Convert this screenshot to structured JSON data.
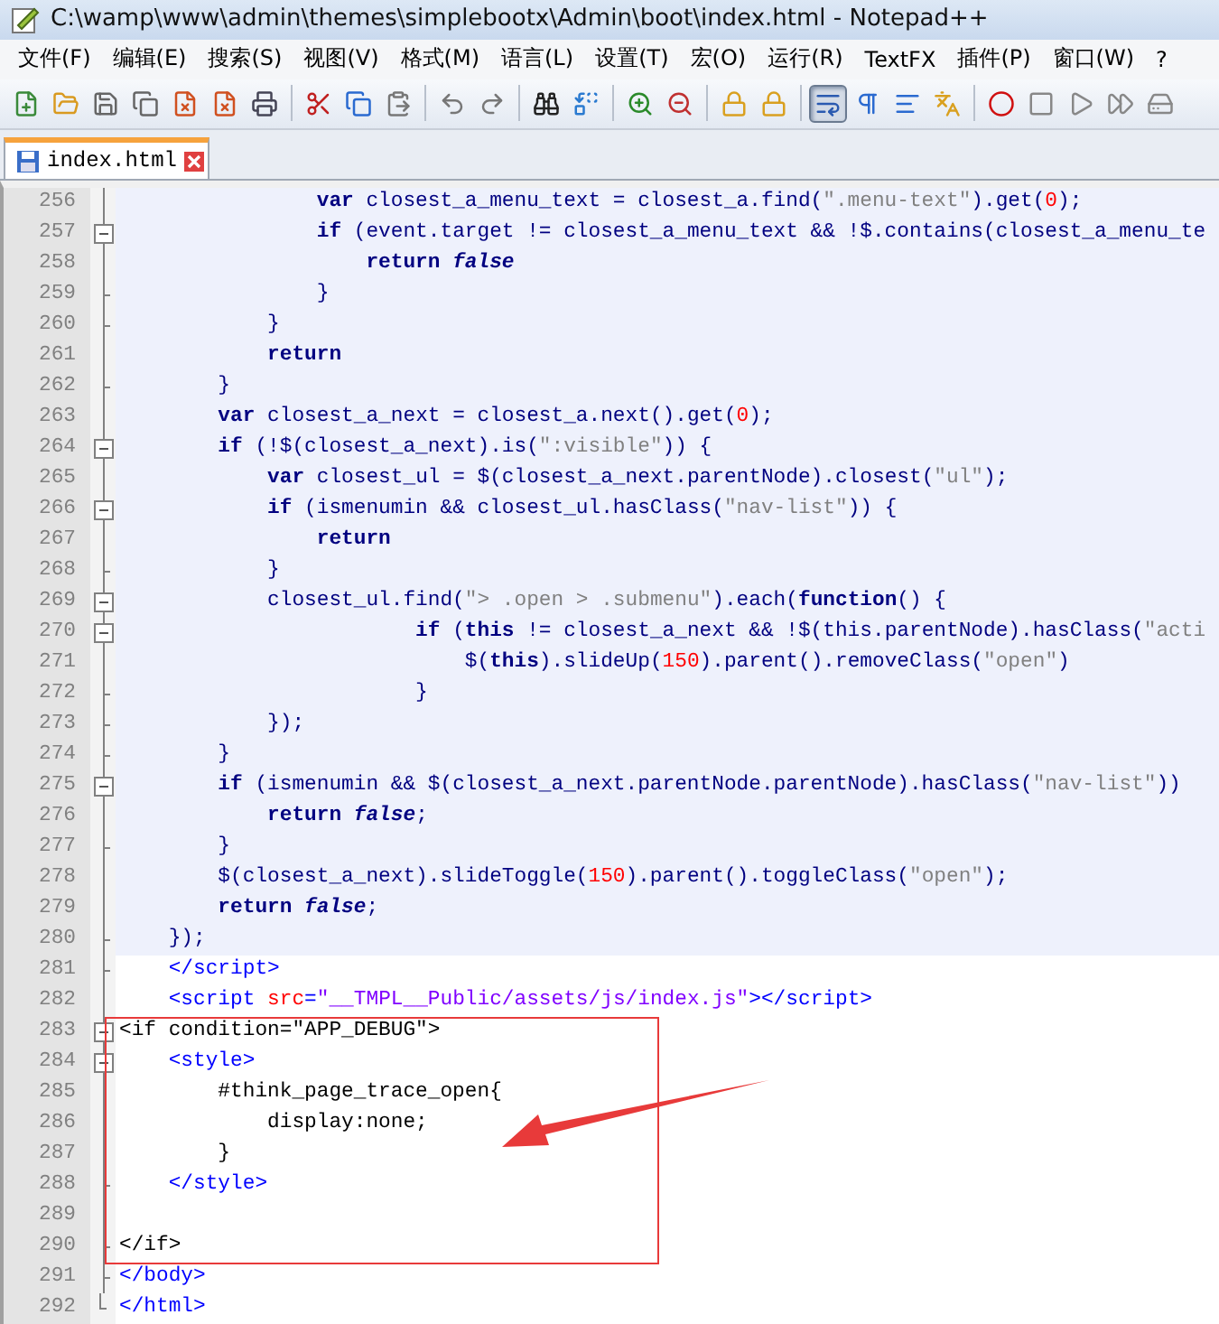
{
  "window": {
    "title": "C:\\wamp\\www\\admin\\themes\\simplebootx\\Admin\\boot\\index.html - Notepad++"
  },
  "menu": [
    "文件(F)",
    "编辑(E)",
    "搜索(S)",
    "视图(V)",
    "格式(M)",
    "语言(L)",
    "设置(T)",
    "宏(O)",
    "运行(R)",
    "TextFX",
    "插件(P)",
    "窗口(W)",
    "?"
  ],
  "toolbar": [
    {
      "kind": "new",
      "pressed": false
    },
    {
      "kind": "open",
      "pressed": false
    },
    {
      "kind": "save",
      "pressed": false
    },
    {
      "kind": "saveall",
      "pressed": false
    },
    {
      "kind": "close",
      "pressed": false
    },
    {
      "kind": "closeall",
      "pressed": false
    },
    {
      "kind": "print",
      "pressed": false
    },
    {
      "kind": "sep"
    },
    {
      "kind": "cut",
      "pressed": false
    },
    {
      "kind": "copy",
      "pressed": false
    },
    {
      "kind": "paste",
      "pressed": false
    },
    {
      "kind": "sep"
    },
    {
      "kind": "undo",
      "pressed": false
    },
    {
      "kind": "redo",
      "pressed": false
    },
    {
      "kind": "sep"
    },
    {
      "kind": "find",
      "pressed": false
    },
    {
      "kind": "replace",
      "pressed": false
    },
    {
      "kind": "sep"
    },
    {
      "kind": "zoomin",
      "pressed": false
    },
    {
      "kind": "zoomout",
      "pressed": false
    },
    {
      "kind": "sep"
    },
    {
      "kind": "syncv",
      "pressed": false
    },
    {
      "kind": "synch",
      "pressed": false
    },
    {
      "kind": "sep"
    },
    {
      "kind": "wrap",
      "pressed": true
    },
    {
      "kind": "allchars",
      "pressed": false
    },
    {
      "kind": "indent",
      "pressed": false
    },
    {
      "kind": "udl",
      "pressed": false
    },
    {
      "kind": "sep"
    },
    {
      "kind": "record",
      "pressed": false
    },
    {
      "kind": "stop",
      "pressed": false
    },
    {
      "kind": "play",
      "pressed": false
    },
    {
      "kind": "playmulti",
      "pressed": false
    },
    {
      "kind": "macro",
      "pressed": false
    }
  ],
  "tabs": [
    {
      "label": "index.html",
      "selected": true
    }
  ],
  "lines": [
    {
      "number": "256",
      "kind": "line",
      "shaded": true,
      "segments": [
        {
          "kind": "kw",
          "text": "                var"
        },
        {
          "kind": "op",
          "text": " closest_a_menu_text = closest_a.find("
        },
        {
          "kind": "str",
          "text": "\".menu-text\""
        },
        {
          "kind": "op",
          "text": ").get("
        },
        {
          "kind": "num",
          "text": "0"
        },
        {
          "kind": "op",
          "text": ");"
        }
      ]
    },
    {
      "number": "257",
      "kind": "open",
      "shaded": true,
      "segments": [
        {
          "kind": "kw",
          "text": "                if"
        },
        {
          "kind": "op",
          "text": " (event.target != closest_a_menu_text && !$.contains(closest_a_menu_te"
        }
      ]
    },
    {
      "number": "258",
      "kind": "line",
      "shaded": true,
      "segments": [
        {
          "kind": "kw",
          "text": "                    return"
        },
        {
          "kind": "ital",
          "text": " false"
        }
      ]
    },
    {
      "number": "259",
      "kind": "end",
      "shaded": true,
      "segments": [
        {
          "kind": "op",
          "text": "                }"
        }
      ]
    },
    {
      "number": "260",
      "kind": "end",
      "shaded": true,
      "segments": [
        {
          "kind": "op",
          "text": "            }"
        }
      ]
    },
    {
      "number": "261",
      "kind": "line",
      "shaded": true,
      "segments": [
        {
          "kind": "kw",
          "text": "            return"
        }
      ]
    },
    {
      "number": "262",
      "kind": "end",
      "shaded": true,
      "segments": [
        {
          "kind": "op",
          "text": "        }"
        }
      ]
    },
    {
      "number": "263",
      "kind": "line",
      "shaded": true,
      "segments": [
        {
          "kind": "kw",
          "text": "        var"
        },
        {
          "kind": "op",
          "text": " closest_a_next = closest_a.next().get("
        },
        {
          "kind": "num",
          "text": "0"
        },
        {
          "kind": "op",
          "text": ");"
        }
      ]
    },
    {
      "number": "264",
      "kind": "open",
      "shaded": true,
      "segments": [
        {
          "kind": "kw",
          "text": "        if"
        },
        {
          "kind": "op",
          "text": " (!$(closest_a_next).is("
        },
        {
          "kind": "str",
          "text": "\":visible\""
        },
        {
          "kind": "op",
          "text": ")) {"
        }
      ]
    },
    {
      "number": "265",
      "kind": "line",
      "shaded": true,
      "segments": [
        {
          "kind": "kw",
          "text": "            var"
        },
        {
          "kind": "op",
          "text": " closest_ul = $(closest_a_next.parentNode).closest("
        },
        {
          "kind": "str",
          "text": "\"ul\""
        },
        {
          "kind": "op",
          "text": ");"
        }
      ]
    },
    {
      "number": "266",
      "kind": "open",
      "shaded": true,
      "segments": [
        {
          "kind": "kw",
          "text": "            if"
        },
        {
          "kind": "op",
          "text": " (ismenumin && closest_ul.hasClass("
        },
        {
          "kind": "str",
          "text": "\"nav-list\""
        },
        {
          "kind": "op",
          "text": ")) {"
        }
      ]
    },
    {
      "number": "267",
      "kind": "line",
      "shaded": true,
      "segments": [
        {
          "kind": "kw",
          "text": "                return"
        }
      ]
    },
    {
      "number": "268",
      "kind": "end",
      "shaded": true,
      "segments": [
        {
          "kind": "op",
          "text": "            }"
        }
      ]
    },
    {
      "number": "269",
      "kind": "open",
      "shaded": true,
      "segments": [
        {
          "kind": "op",
          "text": "            closest_ul.find("
        },
        {
          "kind": "str",
          "text": "\"> .open > .submenu\""
        },
        {
          "kind": "op",
          "text": ").each("
        },
        {
          "kind": "kw",
          "text": "function"
        },
        {
          "kind": "op",
          "text": "() {"
        }
      ]
    },
    {
      "number": "270",
      "kind": "open",
      "shaded": true,
      "segments": [
        {
          "kind": "kw",
          "text": "                        if"
        },
        {
          "kind": "op",
          "text": " ("
        },
        {
          "kind": "kw",
          "text": "this"
        },
        {
          "kind": "op",
          "text": " != closest_a_next && !$(this.parentNode).hasClass("
        },
        {
          "kind": "str",
          "text": "\"acti"
        }
      ]
    },
    {
      "number": "271",
      "kind": "line",
      "shaded": true,
      "segments": [
        {
          "kind": "op",
          "text": "                            $("
        },
        {
          "kind": "kw",
          "text": "this"
        },
        {
          "kind": "op",
          "text": ").slideUp("
        },
        {
          "kind": "num",
          "text": "150"
        },
        {
          "kind": "op",
          "text": ").parent().removeClass("
        },
        {
          "kind": "str",
          "text": "\"open\""
        },
        {
          "kind": "op",
          "text": ")"
        }
      ]
    },
    {
      "number": "272",
      "kind": "end",
      "shaded": true,
      "segments": [
        {
          "kind": "op",
          "text": "                        }"
        }
      ]
    },
    {
      "number": "273",
      "kind": "end",
      "shaded": true,
      "segments": [
        {
          "kind": "op",
          "text": "            });"
        }
      ]
    },
    {
      "number": "274",
      "kind": "end",
      "shaded": true,
      "segments": [
        {
          "kind": "op",
          "text": "        }"
        }
      ]
    },
    {
      "number": "275",
      "kind": "open",
      "shaded": true,
      "segments": [
        {
          "kind": "kw",
          "text": "        if"
        },
        {
          "kind": "op",
          "text": " (ismenumin && $(closest_a_next.parentNode.parentNode).hasClass("
        },
        {
          "kind": "str",
          "text": "\"nav-list\""
        },
        {
          "kind": "op",
          "text": "))"
        }
      ]
    },
    {
      "number": "276",
      "kind": "line",
      "shaded": true,
      "segments": [
        {
          "kind": "kw",
          "text": "            return"
        },
        {
          "kind": "ital",
          "text": " false"
        },
        {
          "kind": "op",
          "text": ";"
        }
      ]
    },
    {
      "number": "277",
      "kind": "end",
      "shaded": true,
      "segments": [
        {
          "kind": "op",
          "text": "        }"
        }
      ]
    },
    {
      "number": "278",
      "kind": "line",
      "shaded": true,
      "segments": [
        {
          "kind": "op",
          "text": "        $(closest_a_next).slideToggle("
        },
        {
          "kind": "num",
          "text": "150"
        },
        {
          "kind": "op",
          "text": ").parent().toggleClass("
        },
        {
          "kind": "str",
          "text": "\"open\""
        },
        {
          "kind": "op",
          "text": ");"
        }
      ]
    },
    {
      "number": "279",
      "kind": "line",
      "shaded": true,
      "segments": [
        {
          "kind": "kw",
          "text": "        return"
        },
        {
          "kind": "ital",
          "text": " false"
        },
        {
          "kind": "op",
          "text": ";"
        }
      ]
    },
    {
      "number": "280",
      "kind": "end",
      "shaded": true,
      "segments": [
        {
          "kind": "op",
          "text": "    });"
        }
      ]
    },
    {
      "number": "281",
      "kind": "end",
      "shaded": false,
      "segments": [
        {
          "kind": "tag",
          "text": "    </script>"
        }
      ]
    },
    {
      "number": "282",
      "kind": "line",
      "shaded": false,
      "segments": [
        {
          "kind": "tag",
          "text": "    <script "
        },
        {
          "kind": "attr",
          "text": "src"
        },
        {
          "kind": "tag",
          "text": "="
        },
        {
          "kind": "val",
          "text": "\"__TMPL__Public/assets/js/index.js\""
        },
        {
          "kind": "tag",
          "text": "></script>"
        }
      ]
    },
    {
      "number": "283",
      "kind": "open",
      "shaded": false,
      "segments": [
        {
          "kind": "text",
          "text": "<if condition=\"APP_DEBUG\">"
        }
      ]
    },
    {
      "number": "284",
      "kind": "open",
      "shaded": false,
      "segments": [
        {
          "kind": "tag",
          "text": "    <style>"
        }
      ]
    },
    {
      "number": "285",
      "kind": "line",
      "shaded": false,
      "segments": [
        {
          "kind": "text",
          "text": "        #think_page_trace_open{"
        }
      ]
    },
    {
      "number": "286",
      "kind": "line",
      "shaded": false,
      "segments": [
        {
          "kind": "text",
          "text": "            display:none;"
        }
      ]
    },
    {
      "number": "287",
      "kind": "line",
      "shaded": false,
      "segments": [
        {
          "kind": "text",
          "text": "        }"
        }
      ]
    },
    {
      "number": "288",
      "kind": "end",
      "shaded": false,
      "segments": [
        {
          "kind": "tag",
          "text": "    </style>"
        }
      ]
    },
    {
      "number": "289",
      "kind": "line",
      "shaded": false
    },
    {
      "number": "290",
      "kind": "end",
      "shaded": false,
      "segments": [
        {
          "kind": "text",
          "text": "</if>"
        }
      ]
    },
    {
      "number": "291",
      "kind": "end",
      "shaded": false,
      "segments": [
        {
          "kind": "tag",
          "text": "</body>"
        }
      ]
    },
    {
      "number": "292",
      "kind": "last",
      "shaded": false,
      "segments": [
        {
          "kind": "tag",
          "text": "</html>"
        }
      ]
    }
  ]
}
